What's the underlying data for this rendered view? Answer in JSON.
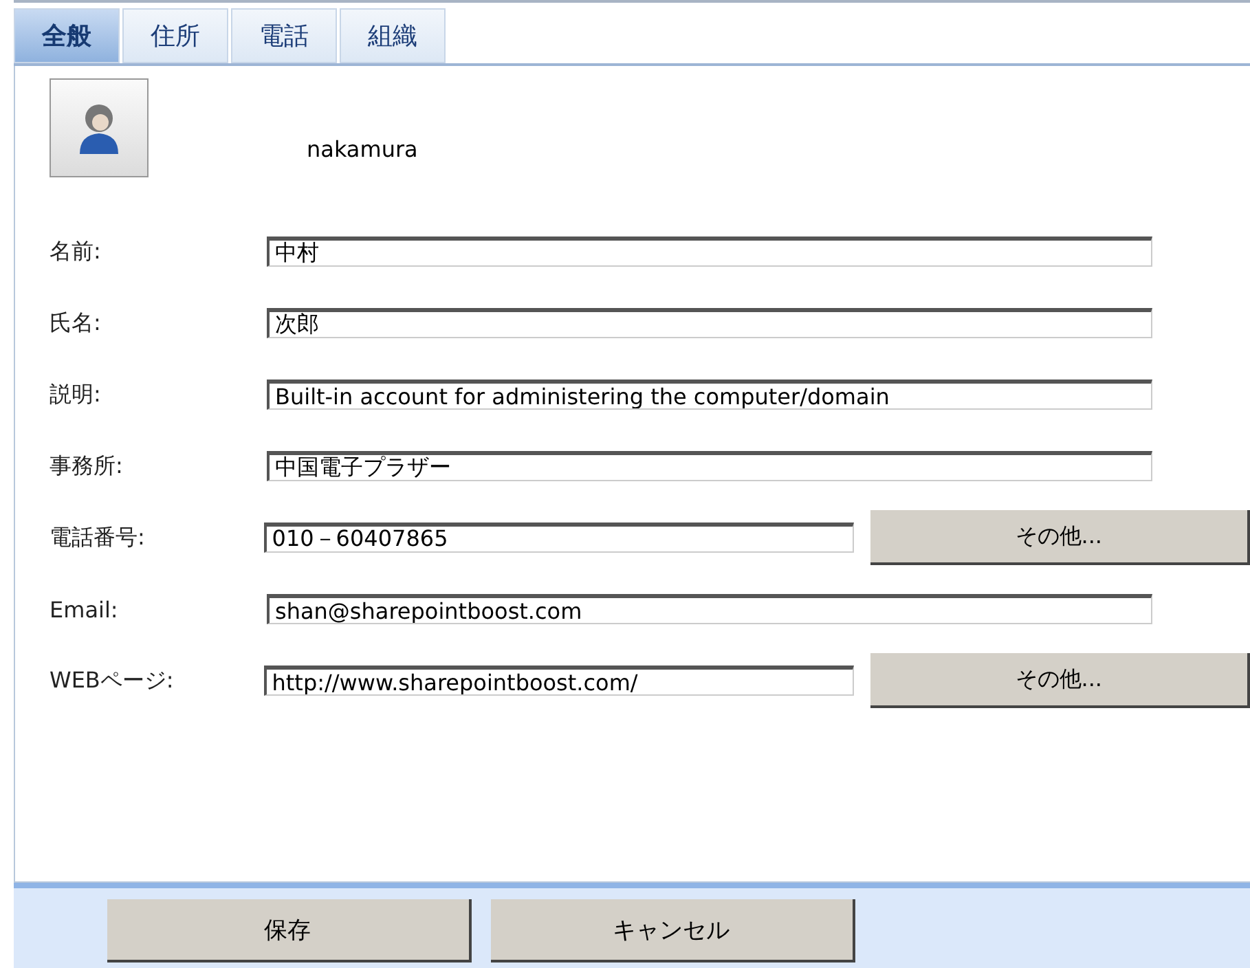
{
  "tabs": [
    {
      "label": "全般",
      "selected": true
    },
    {
      "label": "住所",
      "selected": false
    },
    {
      "label": "電話",
      "selected": false
    },
    {
      "label": "組織",
      "selected": false
    }
  ],
  "user": {
    "name": "nakamura"
  },
  "fields": [
    {
      "kind": "text",
      "label": "名前:",
      "value": "中村"
    },
    {
      "kind": "text",
      "label": "氏名:",
      "value": "次郎"
    },
    {
      "kind": "text",
      "label": "説明:",
      "value": "Built-in account for administering the computer/domain"
    },
    {
      "kind": "text",
      "label": "事務所:",
      "value": "中国電子プラザー"
    },
    {
      "kind": "more",
      "label": "電話番号:",
      "value": "010－60407865",
      "button": "その他..."
    },
    {
      "kind": "text",
      "label": "Email:",
      "value": "shan@sharepointboost.com"
    },
    {
      "kind": "more",
      "label": "WEBページ:",
      "value": "http://www.sharepointboost.com/",
      "button": "その他..."
    }
  ],
  "buttons": [
    "保存",
    "キャンセル"
  ]
}
